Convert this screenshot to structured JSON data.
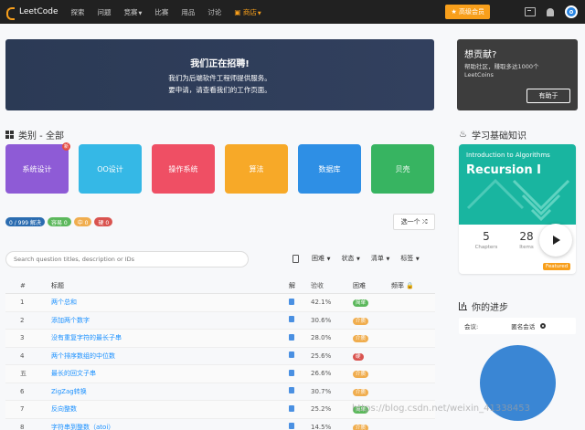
{
  "nav": {
    "logo": "LeetCode",
    "items": [
      {
        "label": "探索"
      },
      {
        "label": "问题"
      },
      {
        "label": "竞赛"
      },
      {
        "label": "比赛"
      },
      {
        "label": "用品"
      },
      {
        "label": "讨论"
      },
      {
        "label": "商店"
      }
    ],
    "premium_label": "高级会员"
  },
  "hero": {
    "title": "我们正在招聘!",
    "line1": "我们为后端软件工程师提供服务。",
    "line2": "要申请，请查看我们的工作页面。"
  },
  "contribute": {
    "title": "想贡献?",
    "desc": "帮助社区，赚取多达1000个LeetCoins",
    "button": "有助于"
  },
  "category": {
    "title": "类别 - 全部",
    "items": [
      {
        "label": "系统设计",
        "color": "#8e5bd6",
        "badge": "新"
      },
      {
        "label": "OO设计",
        "color": "#35b8e6"
      },
      {
        "label": "操作系统",
        "color": "#ef4f64"
      },
      {
        "label": "算法",
        "color": "#f7a928"
      },
      {
        "label": "数据库",
        "color": "#2e8fe5"
      },
      {
        "label": "贝壳",
        "color": "#37b461"
      }
    ]
  },
  "stats": {
    "solved": "0 / 999 解决",
    "easy": "容易 0",
    "medium": "中 0",
    "hard": "硬 0",
    "pick_one": "选一个"
  },
  "search": {
    "placeholder": "Search question titles, description or IDs"
  },
  "filters": {
    "difficulty": "困难",
    "status": "状态",
    "list": "清单",
    "tags": "标签"
  },
  "table": {
    "headers": {
      "num": "#",
      "title": "标题",
      "solution": "解",
      "acceptance": "验收",
      "difficulty": "困难",
      "frequency": "频率"
    },
    "rows": [
      {
        "num": "1",
        "title": "两个总和",
        "acc": "42.1%",
        "diff": "简单",
        "color": "#5cb85c"
      },
      {
        "num": "2",
        "title": "添加两个数字",
        "acc": "30.6%",
        "diff": "介质",
        "color": "#f0ad4e"
      },
      {
        "num": "3",
        "title": "没有重复字符的最长子串",
        "acc": "28.0%",
        "diff": "介质",
        "color": "#f0ad4e"
      },
      {
        "num": "4",
        "title": "两个排序数组的中位数",
        "acc": "25.6%",
        "diff": "硬",
        "color": "#d9534f"
      },
      {
        "num": "五",
        "title": "最长的回文子串",
        "acc": "26.6%",
        "diff": "介质",
        "color": "#f0ad4e"
      },
      {
        "num": "6",
        "title": "ZigZag转换",
        "acc": "30.7%",
        "diff": "介质",
        "color": "#f0ad4e"
      },
      {
        "num": "7",
        "title": "反向整数",
        "acc": "25.2%",
        "diff": "简单",
        "color": "#5cb85c"
      },
      {
        "num": "8",
        "title": "字符串到整数（atoi）",
        "acc": "14.5%",
        "diff": "介质",
        "color": "#f0ad4e"
      }
    ]
  },
  "learn": {
    "heading": "学习基础知识",
    "subtitle": "Introduction to Algorithms",
    "title": "Recursion I",
    "chapters_num": "5",
    "chapters_label": "Chapters",
    "items_num": "28",
    "items_label": "Items",
    "featured": "Featured"
  },
  "progress": {
    "heading": "你的进步",
    "session_label": "会议:",
    "session_value": "匿名会话"
  },
  "watermark": "https://blog.csdn.net/weixin_41338453"
}
